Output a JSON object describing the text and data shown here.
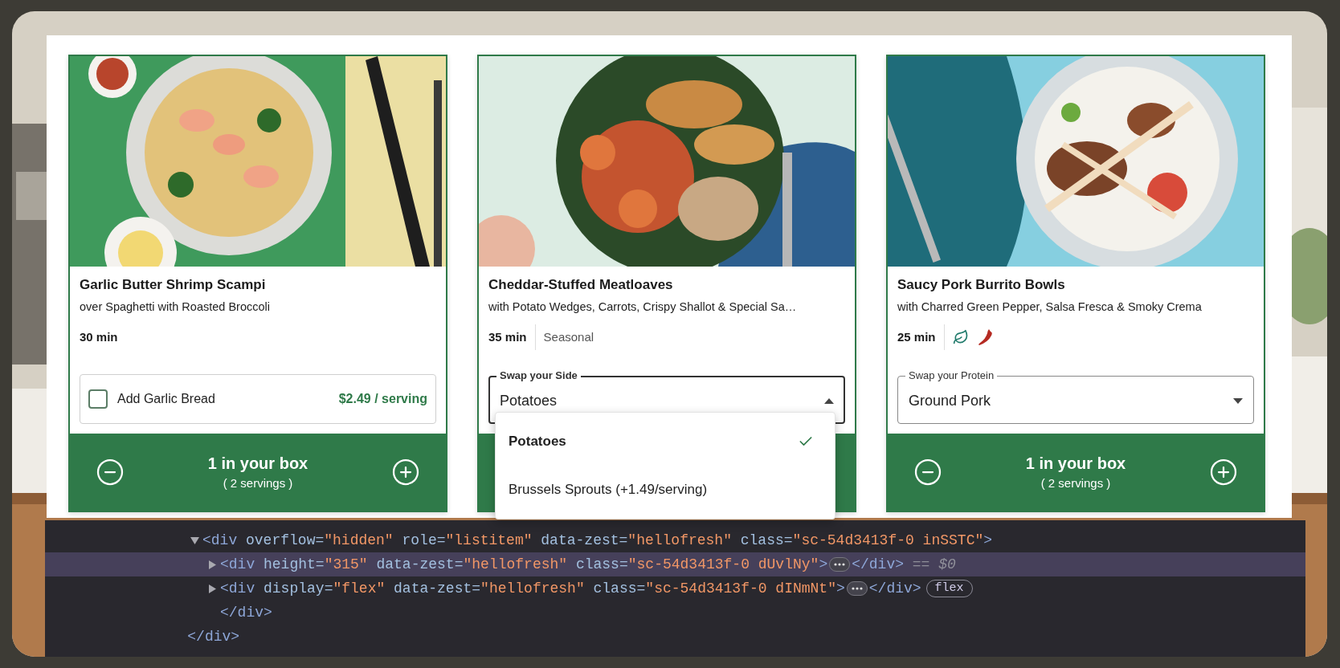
{
  "recipes": [
    {
      "image": {
        "kind": "picture"
      },
      "title": "Garlic Butter Shrimp Scampi",
      "subtitle": "over Spaghetti with Roasted Broccoli",
      "time": "30 min",
      "option": {
        "kind": "addon",
        "label": "Add Garlic Bread",
        "price": "$2.49 / serving",
        "checked": false
      },
      "box": {
        "count": "1 in your box",
        "servings": "( 2 servings )"
      }
    },
    {
      "image": {
        "kind": "picture"
      },
      "title": "Cheddar-Stuffed Meatloaves",
      "subtitle": "with Potato Wedges, Carrots, Crispy Shallot & Special Sa…",
      "time": "35 min",
      "tags": [
        {
          "kind": "text",
          "label": "Seasonal"
        }
      ],
      "option": {
        "kind": "select",
        "label": "Swap your Side",
        "value": "Potatoes",
        "expanded": true,
        "choices": [
          {
            "label": "Potatoes",
            "selected": true
          },
          {
            "label": "Brussels Sprouts (+1.49/serving)",
            "selected": false
          }
        ]
      }
    },
    {
      "image": {
        "kind": "picture"
      },
      "title": "Saucy Pork Burrito Bowls",
      "subtitle": "with Charred Green Pepper, Salsa Fresca & Smoky Crema",
      "time": "25 min",
      "tags": [
        {
          "kind": "leaf"
        },
        {
          "kind": "chili"
        }
      ],
      "option": {
        "kind": "select",
        "label": "Swap your Protein",
        "value": "Ground Pork",
        "expanded": false
      },
      "box": {
        "count": "1 in your box",
        "servings": "( 2 servings )"
      }
    }
  ],
  "devtools": {
    "tree": [
      {
        "close": "</div>",
        "children": [
          {
            "expanded": true,
            "selected": false,
            "close": "</div>",
            "tokens": [
              {
                "kind": "tag",
                "text": "<div"
              },
              {
                "kind": "attr",
                "text": " overflow="
              },
              {
                "kind": "value",
                "text": "\"hidden\""
              },
              {
                "kind": "attr",
                "text": " role="
              },
              {
                "kind": "value",
                "text": "\"listitem\""
              },
              {
                "kind": "attr",
                "text": " data-zest="
              },
              {
                "kind": "value",
                "text": "\"hellofresh\""
              },
              {
                "kind": "attr",
                "text": " class="
              },
              {
                "kind": "value",
                "text": "\"sc-54d3413f-0 inSSTC\""
              },
              {
                "kind": "tag",
                "text": ">"
              }
            ],
            "children": [
              {
                "expanded": false,
                "selected": true,
                "tokens": [
                  {
                    "kind": "tag",
                    "text": "<div"
                  },
                  {
                    "kind": "attr",
                    "text": " height="
                  },
                  {
                    "kind": "value",
                    "text": "\"315\""
                  },
                  {
                    "kind": "attr",
                    "text": " data-zest="
                  },
                  {
                    "kind": "value",
                    "text": "\"hellofresh\""
                  },
                  {
                    "kind": "attr",
                    "text": " class="
                  },
                  {
                    "kind": "value",
                    "text": "\"sc-54d3413f-0 dUvlNy\""
                  },
                  {
                    "kind": "tag",
                    "text": ">"
                  },
                  {
                    "kind": "ellipsis"
                  },
                  {
                    "kind": "tag",
                    "text": "</div>"
                  },
                  {
                    "kind": "ref",
                    "text": " == $0"
                  }
                ]
              },
              {
                "expanded": false,
                "selected": false,
                "tokens": [
                  {
                    "kind": "tag",
                    "text": "<div"
                  },
                  {
                    "kind": "attr",
                    "text": " display="
                  },
                  {
                    "kind": "value",
                    "text": "\"flex\""
                  },
                  {
                    "kind": "attr",
                    "text": " data-zest="
                  },
                  {
                    "kind": "value",
                    "text": "\"hellofresh\""
                  },
                  {
                    "kind": "attr",
                    "text": " class="
                  },
                  {
                    "kind": "value",
                    "text": "\"sc-54d3413f-0 dINmNt\""
                  },
                  {
                    "kind": "tag",
                    "text": ">"
                  },
                  {
                    "kind": "ellipsis"
                  },
                  {
                    "kind": "tag",
                    "text": "</div>"
                  },
                  {
                    "kind": "badge",
                    "text": "flex"
                  }
                ]
              }
            ]
          }
        ]
      }
    ]
  }
}
